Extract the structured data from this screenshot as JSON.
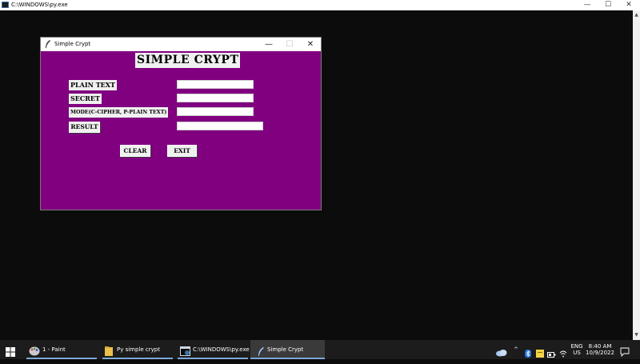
{
  "console": {
    "title": "C:\\WINDOWS\\py.exe",
    "controls": {
      "minimize": "—",
      "maximize": "☐",
      "close": "✕"
    },
    "scroll_up": "▲",
    "scroll_down": "▼"
  },
  "tk_window": {
    "title": "Simple Crypt",
    "controls": {
      "minimize": "—",
      "maximize": "☐",
      "close": "✕"
    },
    "heading": "SIMPLE CRYPT",
    "labels": {
      "plain_text": "PLAIN TEXT",
      "secret": "SECRET",
      "mode": "MODE(C-CIPHER, P-PLAIN TEXT)",
      "result": "RESULT"
    },
    "fields": {
      "plain_text_value": "",
      "secret_value": "",
      "mode_value": "",
      "result_value": ""
    },
    "buttons": {
      "clear": "CLEAR",
      "exit": "EXIT"
    },
    "colors": {
      "background": "#800080"
    }
  },
  "taskbar": {
    "items": [
      {
        "label": "1 - Paint"
      },
      {
        "label": "Py simple crypt"
      },
      {
        "label": "C:\\WINDOWS\\py.exe"
      },
      {
        "label": "Simple Crypt"
      }
    ],
    "tray": {
      "language": "ENG",
      "region": "US",
      "time": "8:40 AM",
      "date": "10/9/2022",
      "caret": "^"
    }
  }
}
